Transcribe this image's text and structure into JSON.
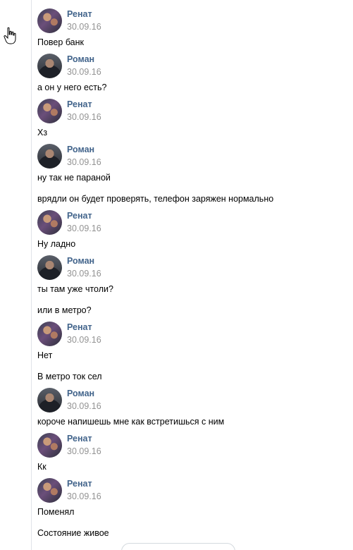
{
  "colors": {
    "author": "#42648b",
    "date": "#939393",
    "text": "#000000",
    "divider": "#dfe3e8"
  },
  "messages": [
    {
      "author": "Ренат",
      "avatar": "renat",
      "date": "30.09.16",
      "texts": [
        "Повер банк"
      ]
    },
    {
      "author": "Роман",
      "avatar": "roman",
      "date": "30.09.16",
      "texts": [
        "а он у него есть?"
      ]
    },
    {
      "author": "Ренат",
      "avatar": "renat",
      "date": "30.09.16",
      "texts": [
        "Хз"
      ]
    },
    {
      "author": "Роман",
      "avatar": "roman",
      "date": "30.09.16",
      "texts": [
        "ну так не параной",
        "врядли он будет проверять, телефон заряжен нормально"
      ]
    },
    {
      "author": "Ренат",
      "avatar": "renat",
      "date": "30.09.16",
      "texts": [
        "Ну ладно"
      ]
    },
    {
      "author": "Роман",
      "avatar": "roman",
      "date": "30.09.16",
      "texts": [
        "ты там уже чтоли?",
        "или в метро?"
      ]
    },
    {
      "author": "Ренат",
      "avatar": "renat",
      "date": "30.09.16",
      "texts": [
        "Нет",
        "В метро ток сел"
      ]
    },
    {
      "author": "Роман",
      "avatar": "roman",
      "date": "30.09.16",
      "texts": [
        "короче напишешь мне как встретишься с ним"
      ]
    },
    {
      "author": "Ренат",
      "avatar": "renat",
      "date": "30.09.16",
      "texts": [
        "Кк"
      ]
    },
    {
      "author": "Ренат",
      "avatar": "renat",
      "date": "30.09.16",
      "texts": [
        "Поменял",
        "Состояние живое"
      ]
    }
  ]
}
